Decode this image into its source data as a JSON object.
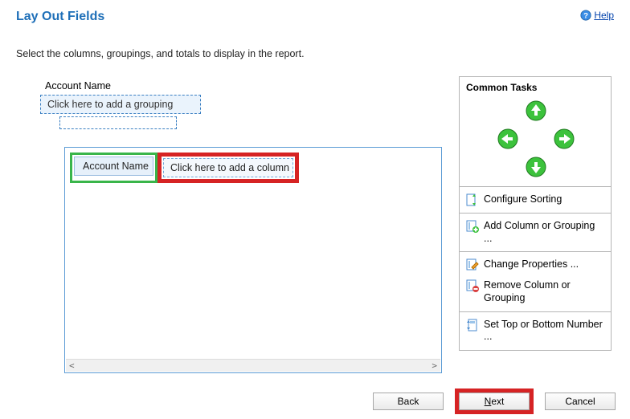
{
  "header": {
    "title": "Lay Out Fields",
    "help_label": "Help",
    "intro": "Select the columns, groupings, and totals to display in the report."
  },
  "layout": {
    "field_label": "Account Name",
    "grouping_placeholder": "Click here to add a grouping",
    "columns": {
      "account_name": "Account Name",
      "add_column_placeholder": "Click here to add a column"
    }
  },
  "tasks": {
    "title": "Common Tasks",
    "configure_sorting": "Configure Sorting",
    "add_column_grouping": "Add Column or Grouping ...",
    "change_properties": "Change Properties ...",
    "remove_column_grouping": "Remove Column or Grouping",
    "set_top_bottom": "Set Top or Bottom Number ..."
  },
  "footer": {
    "back": "Back",
    "next_prefix": "N",
    "next_rest": "ext",
    "cancel": "Cancel"
  }
}
